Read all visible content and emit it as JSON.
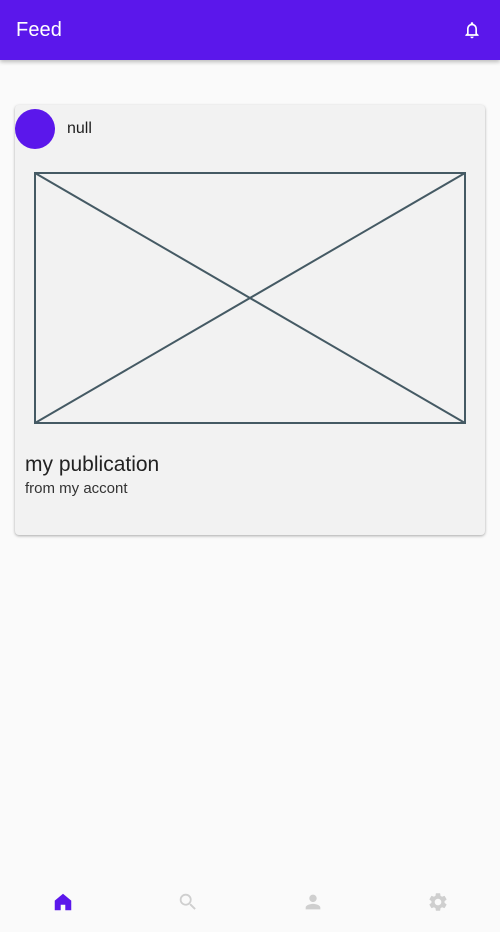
{
  "app_bar": {
    "title": "Feed",
    "notification_icon": "bell-icon"
  },
  "colors": {
    "primary": "#5b17eb",
    "background": "#fafafa",
    "card": "#f2f2f2",
    "nav_inactive": "#cfcfcf",
    "placeholder_stroke": "#455a64"
  },
  "post": {
    "author_name": "null",
    "image": "image-placeholder",
    "title": "my publication",
    "subtitle": "from my accont"
  },
  "bottom_nav": {
    "items": [
      {
        "icon": "home-icon",
        "active": true
      },
      {
        "icon": "search-icon",
        "active": false
      },
      {
        "icon": "person-icon",
        "active": false
      },
      {
        "icon": "settings-icon",
        "active": false
      }
    ]
  }
}
